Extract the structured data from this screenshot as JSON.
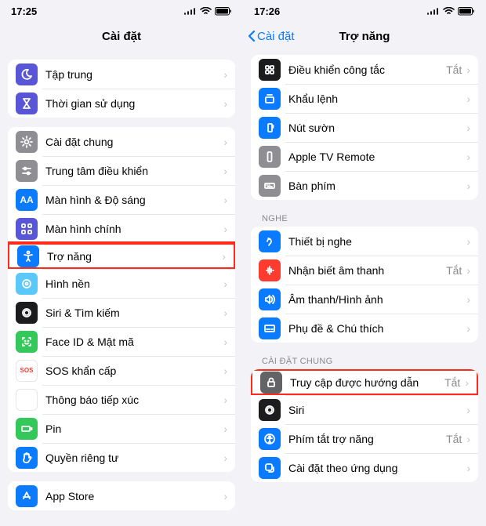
{
  "left": {
    "status_time": "17:25",
    "title": "Cài đặt",
    "groups": [
      {
        "rows": [
          {
            "label": "Tập trung"
          },
          {
            "label": "Thời gian sử dụng"
          }
        ]
      },
      {
        "rows": [
          {
            "label": "Cài đặt chung"
          },
          {
            "label": "Trung tâm điều khiển"
          },
          {
            "label": "Màn hình & Độ sáng"
          },
          {
            "label": "Màn hình chính"
          },
          {
            "label": "Trợ năng",
            "highlight": true
          },
          {
            "label": "Hình nền"
          },
          {
            "label": "Siri & Tìm kiếm"
          },
          {
            "label": "Face ID & Mật mã"
          },
          {
            "label": "SOS khẩn cấp"
          },
          {
            "label": "Thông báo tiếp xúc"
          },
          {
            "label": "Pin"
          },
          {
            "label": "Quyền riêng tư"
          }
        ]
      },
      {
        "rows": [
          {
            "label": "App Store"
          }
        ]
      }
    ]
  },
  "right": {
    "status_time": "17:26",
    "back_label": "Cài đặt",
    "title": "Trợ năng",
    "off_label": "Tắt",
    "groups": [
      {
        "header": null,
        "rows": [
          {
            "label": "Điều khiển công tắc",
            "detail": "Tắt"
          },
          {
            "label": "Khẩu lệnh"
          },
          {
            "label": "Nút sườn"
          },
          {
            "label": "Apple TV Remote"
          },
          {
            "label": "Bàn phím"
          }
        ]
      },
      {
        "header": "NGHE",
        "rows": [
          {
            "label": "Thiết bị nghe"
          },
          {
            "label": "Nhận biết âm thanh",
            "detail": "Tắt"
          },
          {
            "label": "Âm thanh/Hình ảnh"
          },
          {
            "label": "Phụ đề & Chú thích"
          }
        ]
      },
      {
        "header": "CÀI ĐẶT CHUNG",
        "rows": [
          {
            "label": "Truy cập được hướng dẫn",
            "detail": "Tắt",
            "highlight": true
          },
          {
            "label": "Siri"
          },
          {
            "label": "Phím tắt trợ năng",
            "detail": "Tắt"
          },
          {
            "label": "Cài đặt theo ứng dụng"
          }
        ]
      }
    ]
  }
}
